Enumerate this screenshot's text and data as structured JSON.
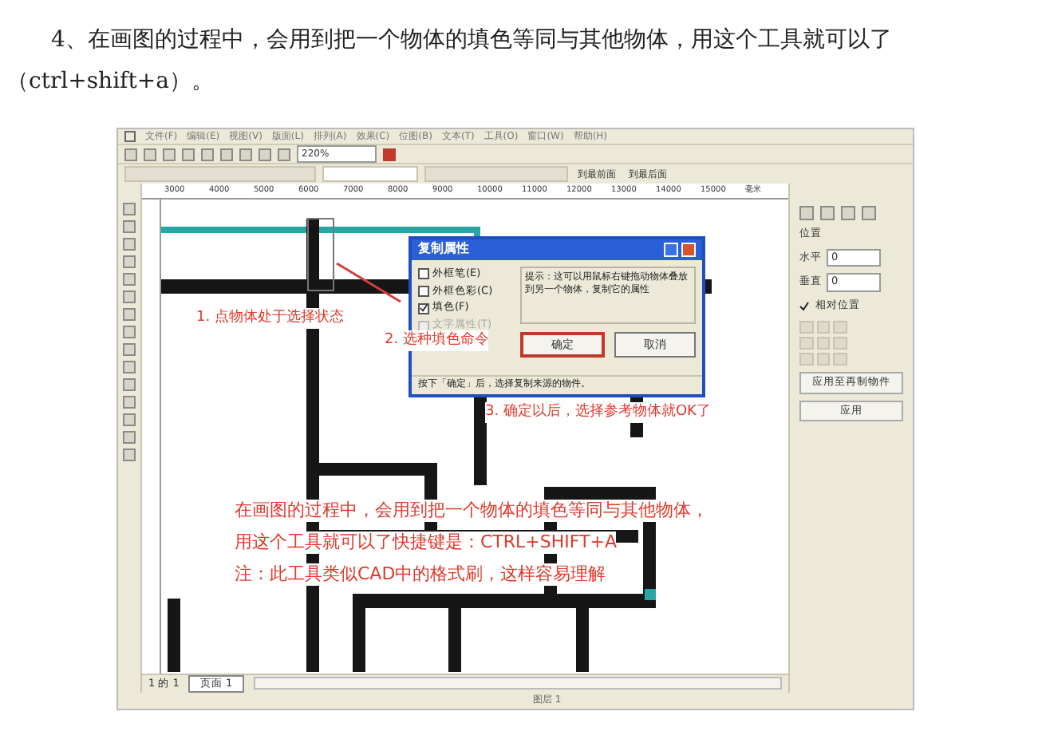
{
  "intro": "4、在画图的过程中，会用到把一个物体的填色等同与其他物体，用这个工具就可以了（ctrl+shift+a）。",
  "app": {
    "menu": [
      "文件(F)",
      "编辑(E)",
      "视图(V)",
      "版面(L)",
      "排列(A)",
      "效果(C)",
      "位图(B)",
      "文本(T)",
      "工具(O)",
      "窗口(W)",
      "帮助(H)"
    ],
    "zoom": "220%",
    "property_buttons": [
      "到最前面",
      "到最后面"
    ],
    "ruler": [
      "3000",
      "4000",
      "5000",
      "6000",
      "7000",
      "8000",
      "9000",
      "10000",
      "11000",
      "12000",
      "13000",
      "14000",
      "15000",
      "毫米"
    ],
    "dialog": {
      "title": "复制属性",
      "options": [
        {
          "label": "外框笔(E)",
          "checked": false,
          "disabled": false
        },
        {
          "label": "外框色彩(C)",
          "checked": false,
          "disabled": false
        },
        {
          "label": "填色(F)",
          "checked": true,
          "disabled": false
        },
        {
          "label": "文字属性(T)",
          "checked": false,
          "disabled": true
        }
      ],
      "hint": "提示：这可以用鼠标右键拖动物体叠放到另一个物体，复制它的属性",
      "ok": "确定",
      "cancel": "取消",
      "footer": "按下「确定」后，选择复制来源的物件。"
    },
    "annotations": [
      "1. 点物体处于选择状态",
      "2. 选种填色命令",
      "3. 确定以后，选择参考物体就OK了"
    ],
    "note": [
      "在画图的过程中，会用到把一个物体的填色等同与其他物体，",
      "用这个工具就可以了快捷键是：CTRL+SHIFT+A",
      "注：此工具类似CAD中的格式刷，这样容易理解"
    ],
    "docker": {
      "section": "位置",
      "fields": [
        {
          "label": "水平",
          "value": "0"
        },
        {
          "label": "垂直",
          "value": "0"
        }
      ],
      "relative": {
        "label": "相对位置",
        "checked": true
      },
      "buttons": [
        "应用至再制物件",
        "应用"
      ]
    },
    "page_nav": {
      "count": "1 的 1",
      "tab": "页面 1"
    },
    "status": "图层 1"
  }
}
